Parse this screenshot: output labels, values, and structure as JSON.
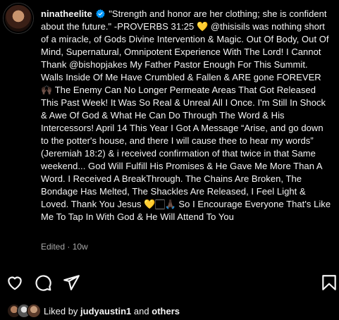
{
  "post": {
    "username": "ninatheelite",
    "caption_part1": "\"Strength and honor are her clothing; she is confident about the future.\" -PROVERBS 31:25",
    "heart_emoji": "💛",
    "mention1": "@thisisils",
    "caption_part2": "was nothing short of a miracle, of Gods Divine Intervention & Magic. Out Of Body, Out Of Mind, Supernatural, Omnipotent Experience With The Lord! I Cannot Thank",
    "mention2": "@bishopjakes",
    "caption_part3": "My Father Pastor Enough For This Summit. Walls Inside Of Me Have Crumbled & Fallen & ARE gone FOREVER",
    "emoji_hands": "🙌🏿",
    "caption_part4": "The Enemy Can No Longer Permeate Areas That Got Released This Past Week! It Was So Real & Unreal All I Once. I'm Still In Shock & Awe Of God & What He Can Do Through The Word & His Intercessors! April 14 This Year I Got A Message “Arise, and go down to the potter's house, and there I will cause thee to hear my words” (Jeremiah 18:2) & i received confirmation of that twice in that Same weekend... God Will Fulfill His Promises & He Gave Me More Than A Word. I Received A BreakThrough. The Chains Are Broken, The Bondage Has Melted, The Shackles Are Released, I Feel Light & Loved. Thank You Jesus",
    "emoji_end": "💛🏻🙏🏿",
    "caption_part5": "So I Encourage Everyone That's Like Me To Tap In With God & He Will Attend To You",
    "meta": "Edited · 10w"
  },
  "icons": {
    "like": "heart-outline-icon",
    "comment": "comment-bubble-icon",
    "share": "paper-plane-icon",
    "save": "bookmark-icon",
    "verified": "verified-badge-icon"
  },
  "likes": {
    "prefix": "Liked by",
    "user": "judyaustin1",
    "conj": "and",
    "others": "others"
  },
  "colors": {
    "background": "#000000",
    "text": "#f5f5f5",
    "muted": "#a8a8a8",
    "verified": "#0095f6",
    "heart_emoji": "#f5c518"
  }
}
